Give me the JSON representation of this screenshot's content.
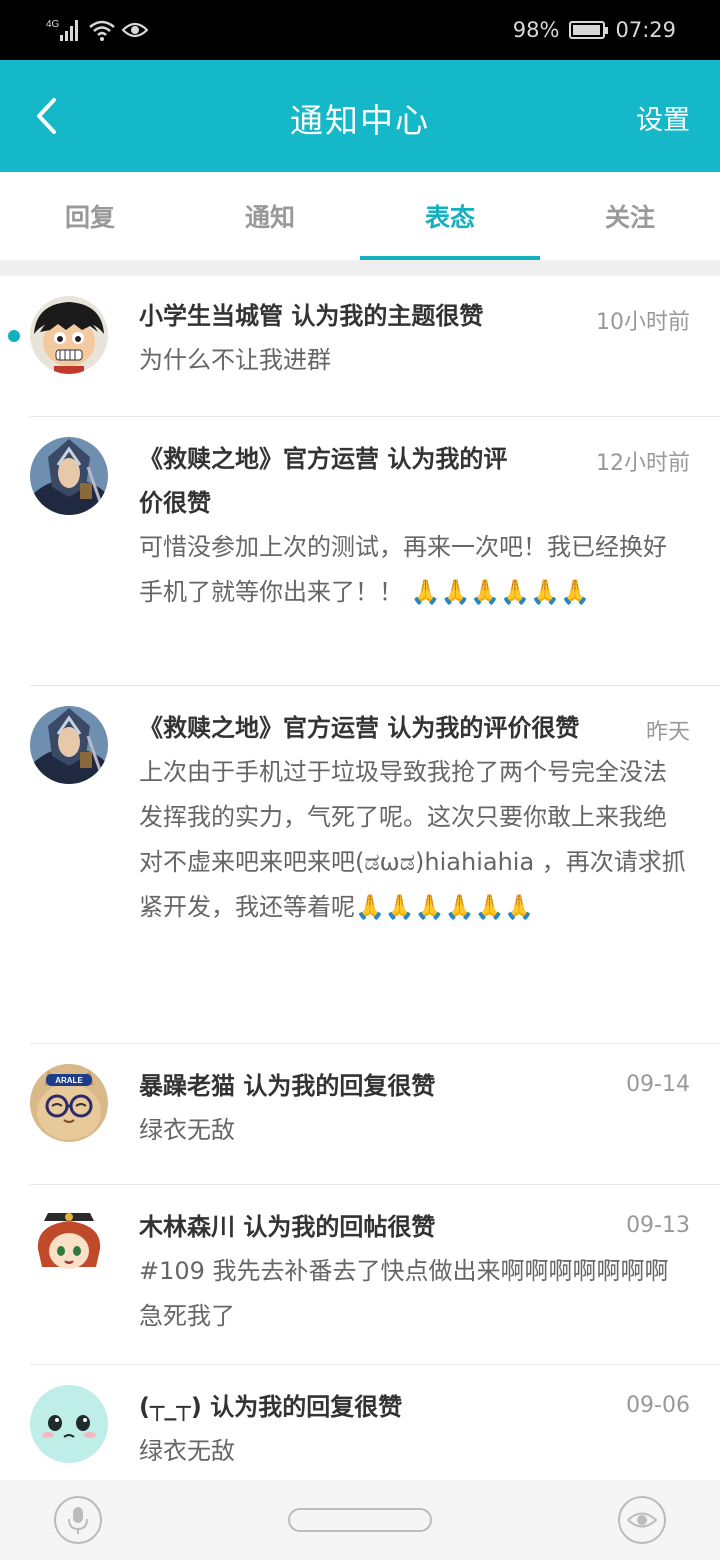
{
  "status_bar": {
    "signal_label": "4G",
    "battery": "98%",
    "time": "07:29",
    "icons": [
      "signal-icon",
      "wifi-icon",
      "eye-icon",
      "battery-icon"
    ]
  },
  "header": {
    "title": "通知中心",
    "settings": "设置"
  },
  "tabs": [
    {
      "label": "回复",
      "active": false
    },
    {
      "label": "通知",
      "active": false
    },
    {
      "label": "表态",
      "active": true
    },
    {
      "label": "关注",
      "active": false
    }
  ],
  "notices": [
    {
      "title": "小学生当城管 认为我的主题很赞",
      "time": "10小时前",
      "text": "为什么不让我进群",
      "unread": true
    },
    {
      "title": "《救赎之地》官方运营 认为我的评价很赞",
      "time": "12小时前",
      "text": "可惜没参加上次的测试，再来一次吧！我已经换好手机了就等你出来了！！ 🙏🙏🙏🙏🙏🙏"
    },
    {
      "title": "《救赎之地》官方运营 认为我的评价很赞",
      "time": "昨天",
      "text": "上次由于手机过于垃圾导致我抢了两个号完全没法发挥我的实力，气死了呢。这次只要你敢上来我绝对不虚来吧来吧来吧(ಡωಡ)hiahiahia ，再次请求抓紧开发，我还等着呢🙏🙏🙏🙏🙏🙏"
    },
    {
      "title": "暴躁老猫 认为我的回复很赞",
      "time": "09-14",
      "text": "绿衣无敌",
      "avatar_badge": "ARALE"
    },
    {
      "title": "木林森川 认为我的回帖很赞",
      "time": "09-13",
      "text": "#109 我先去补番去了快点做出来啊啊啊啊啊啊啊急死我了"
    },
    {
      "title": "(┬_┬) 认为我的回复很赞",
      "time": "09-06",
      "text": "绿衣无敌"
    }
  ],
  "colors": {
    "accent": "#14b8c8",
    "tab_active": "#14b0c0",
    "status_bar": "#000000"
  }
}
